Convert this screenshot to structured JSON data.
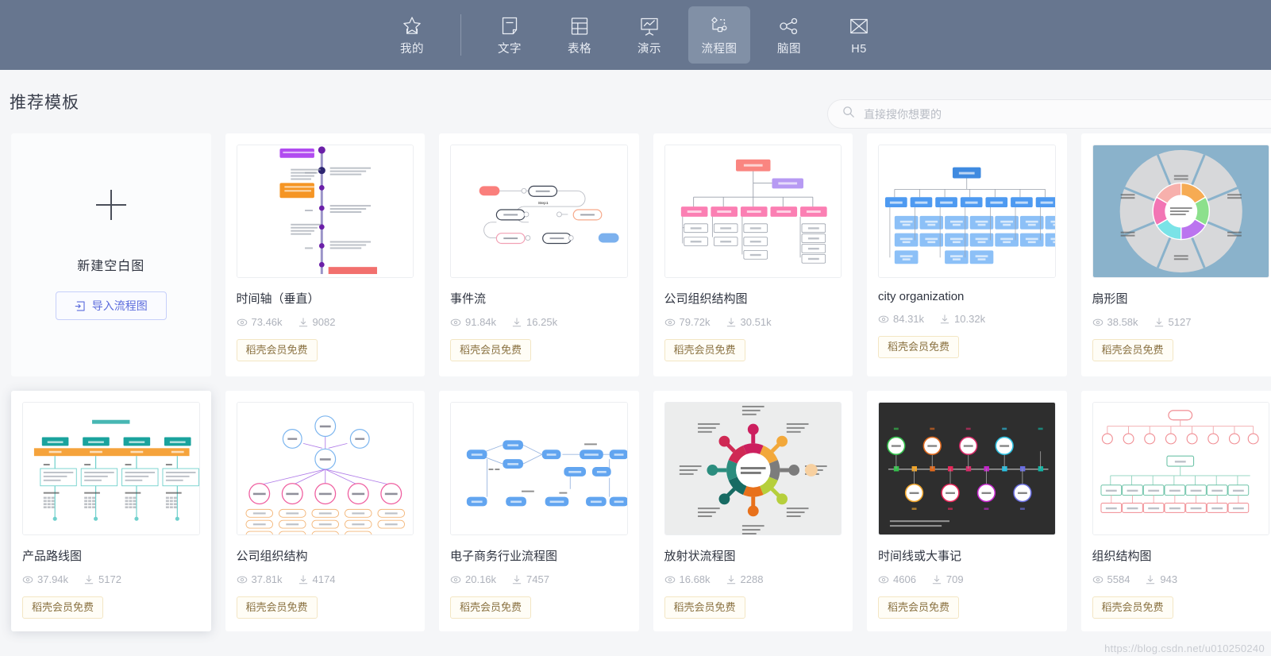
{
  "nav": {
    "items": [
      {
        "label": "我的",
        "icon": "star-icon",
        "active": false
      },
      {
        "label": "文字",
        "icon": "document-icon",
        "active": false
      },
      {
        "label": "表格",
        "icon": "table-icon",
        "active": false
      },
      {
        "label": "演示",
        "icon": "presentation-icon",
        "active": false
      },
      {
        "label": "流程图",
        "icon": "flowchart-icon",
        "active": true
      },
      {
        "label": "脑图",
        "icon": "mindmap-icon",
        "active": false
      },
      {
        "label": "H5",
        "icon": "h5-icon",
        "active": false
      }
    ],
    "background_color": "#67768f",
    "active_color": "#8190a6"
  },
  "header": {
    "title": "推荐模板"
  },
  "search": {
    "placeholder": "直接搜你想要的",
    "value": "",
    "icon": "search-icon"
  },
  "blank_card": {
    "plus_icon": "plus-icon",
    "label": "新建空白图",
    "import_label": "导入流程图",
    "import_icon": "import-icon",
    "accent_color": "#5b6bdc"
  },
  "stat_icons": {
    "views": "eye-icon",
    "downloads": "download-icon"
  },
  "badge_label": "稻壳会员免费",
  "templates": [
    {
      "title": "时间轴（垂直）",
      "views": "73.46k",
      "downloads": "9082",
      "badge": "稻壳会员免费",
      "thumb": "timeline-vertical",
      "hovered": false
    },
    {
      "title": "事件流",
      "views": "91.84k",
      "downloads": "16.25k",
      "badge": "稻壳会员免费",
      "thumb": "event-flow",
      "hovered": false
    },
    {
      "title": "公司组织结构图",
      "views": "79.72k",
      "downloads": "30.51k",
      "badge": "稻壳会员免费",
      "thumb": "org-pink",
      "hovered": false
    },
    {
      "title": "city organization",
      "views": "84.31k",
      "downloads": "10.32k",
      "badge": "稻壳会员免费",
      "thumb": "org-blue",
      "hovered": false
    },
    {
      "title": "扇形图",
      "views": "38.58k",
      "downloads": "5127",
      "badge": "稻壳会员免费",
      "thumb": "sector-wheel",
      "hovered": false
    },
    {
      "title": "产品路线图",
      "views": "37.94k",
      "downloads": "5172",
      "badge": "稻壳会员免费",
      "thumb": "product-roadmap",
      "hovered": true
    },
    {
      "title": "公司组织结构",
      "views": "37.81k",
      "downloads": "4174",
      "badge": "稻壳会员免费",
      "thumb": "org-circles",
      "hovered": false
    },
    {
      "title": "电子商务行业流程图",
      "views": "20.16k",
      "downloads": "7457",
      "badge": "稻壳会员免费",
      "thumb": "ecommerce-flow",
      "hovered": false
    },
    {
      "title": "放射状流程图",
      "views": "16.68k",
      "downloads": "2288",
      "badge": "稻壳会员免费",
      "thumb": "radial-flow",
      "hovered": false
    },
    {
      "title": "时间线或大事记",
      "views": "4606",
      "downloads": "709",
      "badge": "稻壳会员免费",
      "thumb": "timeline-dark",
      "hovered": false
    },
    {
      "title": "组织结构图",
      "views": "5584",
      "downloads": "943",
      "badge": "稻壳会员免费",
      "thumb": "org-red",
      "hovered": false
    }
  ],
  "watermark": "https://blog.csdn.net/u010250240"
}
